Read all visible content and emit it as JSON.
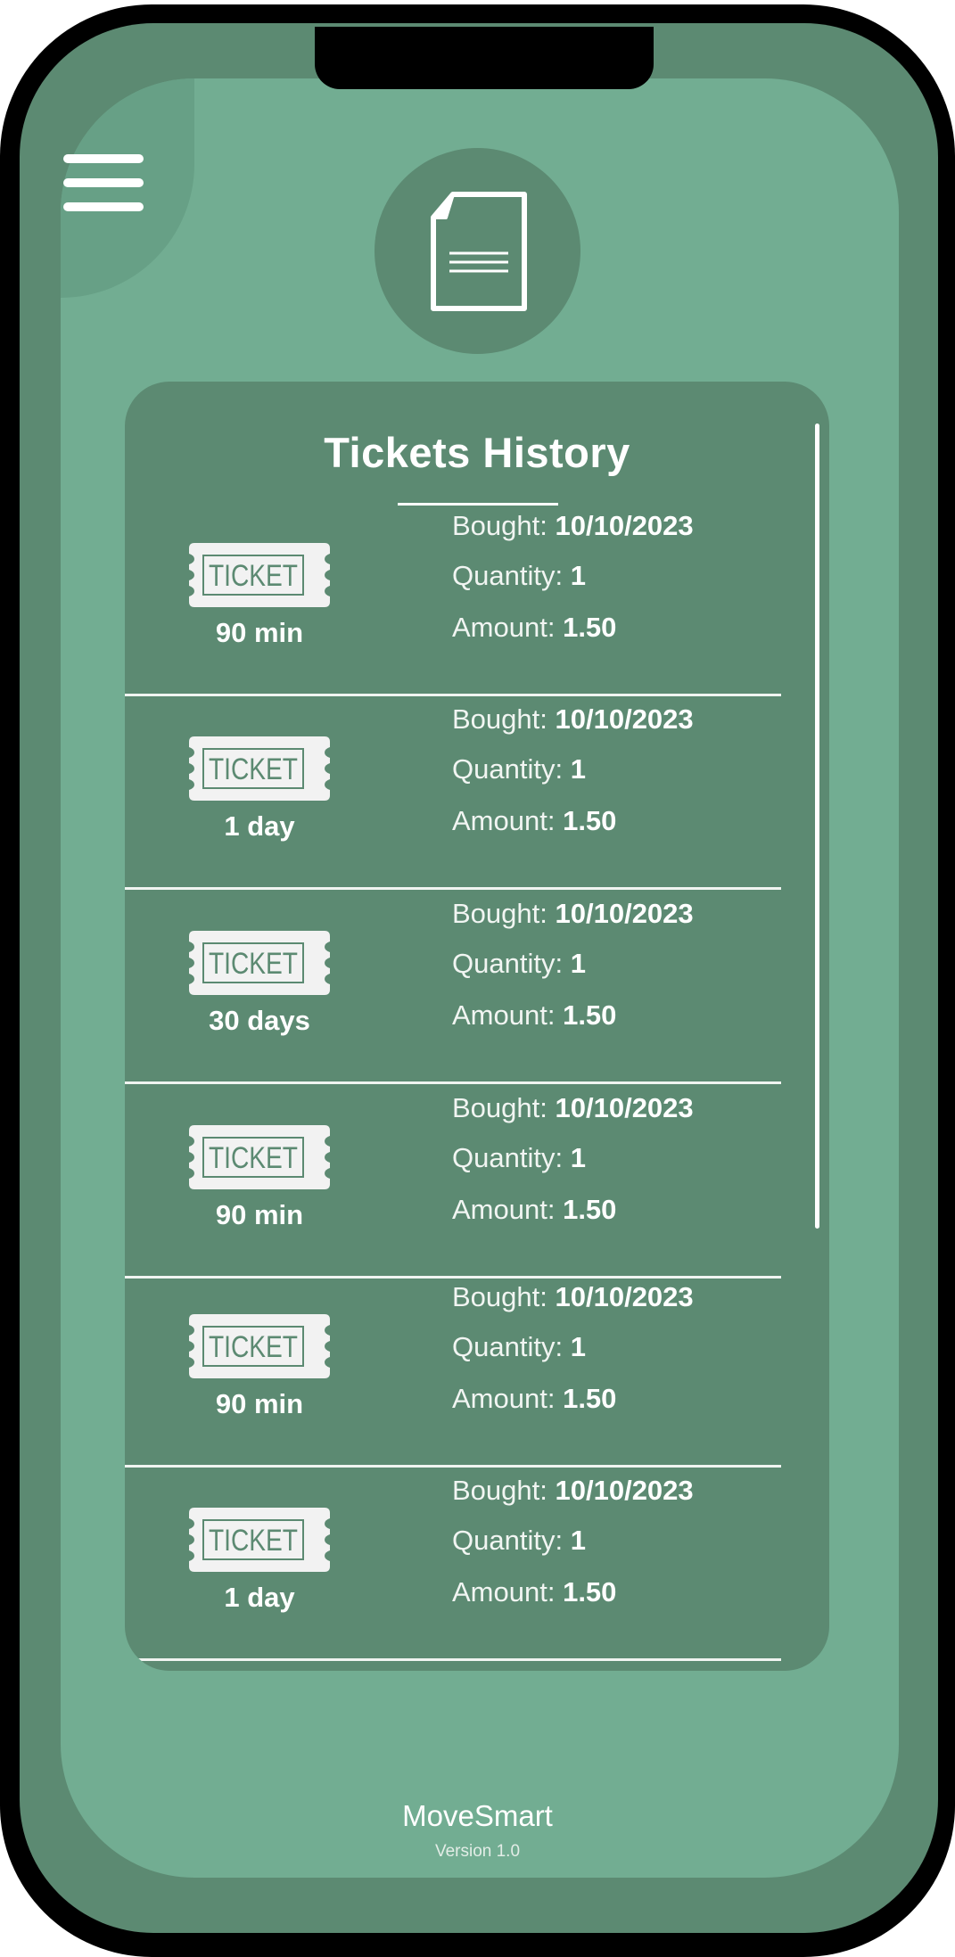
{
  "panel": {
    "title": "Tickets History"
  },
  "tickets": [
    {
      "type": "90 min",
      "icon_text": "TICKET",
      "bought_label": "Bought:",
      "bought_value": "10/10/2023",
      "quantity_label": "Quantity:",
      "quantity_value": "1",
      "amount_label": "Amount:",
      "amount_value": "1.50"
    },
    {
      "type": "1 day",
      "icon_text": "TICKET",
      "bought_label": "Bought:",
      "bought_value": "10/10/2023",
      "quantity_label": "Quantity:",
      "quantity_value": "1",
      "amount_label": "Amount:",
      "amount_value": "1.50"
    },
    {
      "type": "30 days",
      "icon_text": "TICKET",
      "bought_label": "Bought:",
      "bought_value": "10/10/2023",
      "quantity_label": "Quantity:",
      "quantity_value": "1",
      "amount_label": "Amount:",
      "amount_value": "1.50"
    },
    {
      "type": "90 min",
      "icon_text": "TICKET",
      "bought_label": "Bought:",
      "bought_value": "10/10/2023",
      "quantity_label": "Quantity:",
      "quantity_value": "1",
      "amount_label": "Amount:",
      "amount_value": "1.50"
    },
    {
      "type": "90 min",
      "icon_text": "TICKET",
      "bought_label": "Bought:",
      "bought_value": "10/10/2023",
      "quantity_label": "Quantity:",
      "quantity_value": "1",
      "amount_label": "Amount:",
      "amount_value": "1.50"
    },
    {
      "type": "1 day",
      "icon_text": "TICKET",
      "bought_label": "Bought:",
      "bought_value": "10/10/2023",
      "quantity_label": "Quantity:",
      "quantity_value": "1",
      "amount_label": "Amount:",
      "amount_value": "1.50"
    }
  ],
  "footer": {
    "app_name": "MoveSmart",
    "version": "Version 1.0"
  },
  "icons": {
    "menu": "hamburger-menu-icon",
    "header": "document-icon",
    "ticket": "ticket-icon"
  },
  "colors": {
    "screen_bg": "#72ad92",
    "panel_bg": "#5c8a72",
    "bezel": "#5c8a72",
    "frame": "#000000",
    "text": "#ffffff",
    "ticket_bg": "#f2f2f2",
    "ticket_ink": "#5c8a72"
  }
}
